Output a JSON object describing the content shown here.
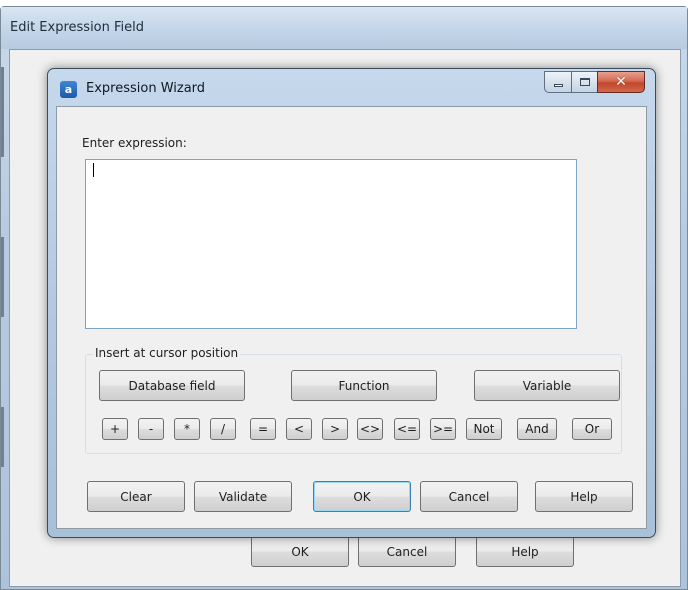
{
  "outer_dialog": {
    "title": "Edit Expression Field",
    "buttons": {
      "ok": "OK",
      "cancel": "Cancel",
      "help": "Help"
    }
  },
  "wizard": {
    "title": "Expression Wizard",
    "app_icon_letter": "a",
    "enter_label": "Enter expression:",
    "expression_value": "",
    "insert_group_label": "Insert at cursor position",
    "insert_buttons": {
      "database_field": "Database field",
      "function": "Function",
      "variable": "Variable"
    },
    "operators": [
      "+",
      "-",
      "*",
      "/",
      "=",
      "<",
      ">",
      "<>",
      "<=",
      ">=",
      "Not",
      "And",
      "Or"
    ],
    "buttons": {
      "clear": "Clear",
      "validate": "Validate",
      "ok": "OK",
      "cancel": "Cancel",
      "help": "Help"
    }
  },
  "colors": {
    "titlebar": "#c3d5e8",
    "close_button": "#c2462c",
    "input_border": "#7fa3c5",
    "default_button_border": "#3c7fb1"
  },
  "icons": {
    "app": "app-icon",
    "minimize": "minimize-icon",
    "maximize": "maximize-icon",
    "close": "close-icon"
  }
}
